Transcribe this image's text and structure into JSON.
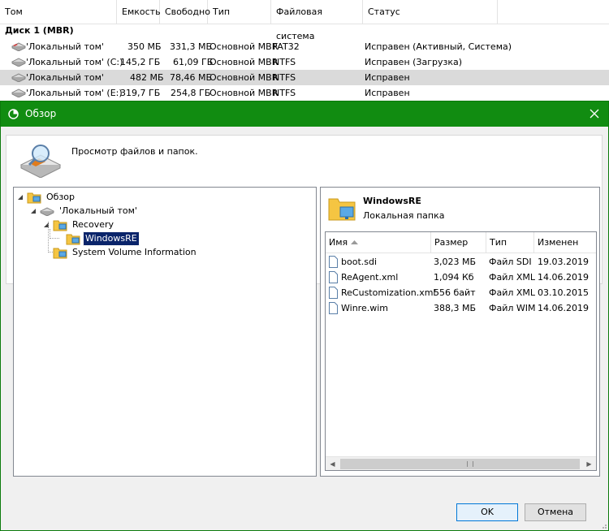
{
  "volume_table": {
    "columns": [
      "Том",
      "Емкость",
      "Свободно",
      "Тип",
      "Файловая система",
      "Статус"
    ],
    "disk_label": "Диск 1 (MBR)",
    "rows": [
      {
        "name": "'Локальный том'",
        "capacity": "350 МБ",
        "free": "331,3 МБ",
        "type": "Основной MBR",
        "fs": "FAT32",
        "status": "Исправен (Активный, Система)"
      },
      {
        "name": "'Локальный том' (C:)",
        "capacity": "145,2 ГБ",
        "free": "61,09 ГБ",
        "type": "Основной MBR",
        "fs": "NTFS",
        "status": "Исправен (Загрузка)"
      },
      {
        "name": "'Локальный том'",
        "capacity": "482 МБ",
        "free": "78,46 МБ",
        "type": "Основной MBR",
        "fs": "NTFS",
        "status": "Исправен"
      },
      {
        "name": "'Локальный том' (E:)",
        "capacity": "319,7 ГБ",
        "free": "254,8 ГБ",
        "type": "Основной MBR",
        "fs": "NTFS",
        "status": "Исправен"
      }
    ]
  },
  "dialog": {
    "title": "Обзор",
    "description": "Просмотр файлов и папок.",
    "tree": {
      "root": "Обзор",
      "volume": "'Локальный том'",
      "recovery": "Recovery",
      "windowsre": "WindowsRE",
      "svi": "System Volume Information"
    },
    "folder": {
      "name": "WindowsRE",
      "type": "Локальная папка"
    },
    "file_columns": [
      "Имя",
      "Размер",
      "Тип",
      "Изменен"
    ],
    "files": [
      {
        "name": "boot.sdi",
        "size": "3,023 МБ",
        "type": "Файл SDI",
        "modified": "19.03.2019"
      },
      {
        "name": "ReAgent.xml",
        "size": "1,094 Кб",
        "type": "Файл XML",
        "modified": "14.06.2019"
      },
      {
        "name": "ReCustomization.xml",
        "size": "556 байт",
        "type": "Файл XML",
        "modified": "03.10.2015"
      },
      {
        "name": "Winre.wim",
        "size": "388,3 МБ",
        "type": "Файл WIM",
        "modified": "14.06.2019"
      }
    ],
    "ok_label": "OK",
    "cancel_label": "Отмена"
  },
  "colors": {
    "titlebar": "#118c11",
    "selection": "#0a246a"
  }
}
